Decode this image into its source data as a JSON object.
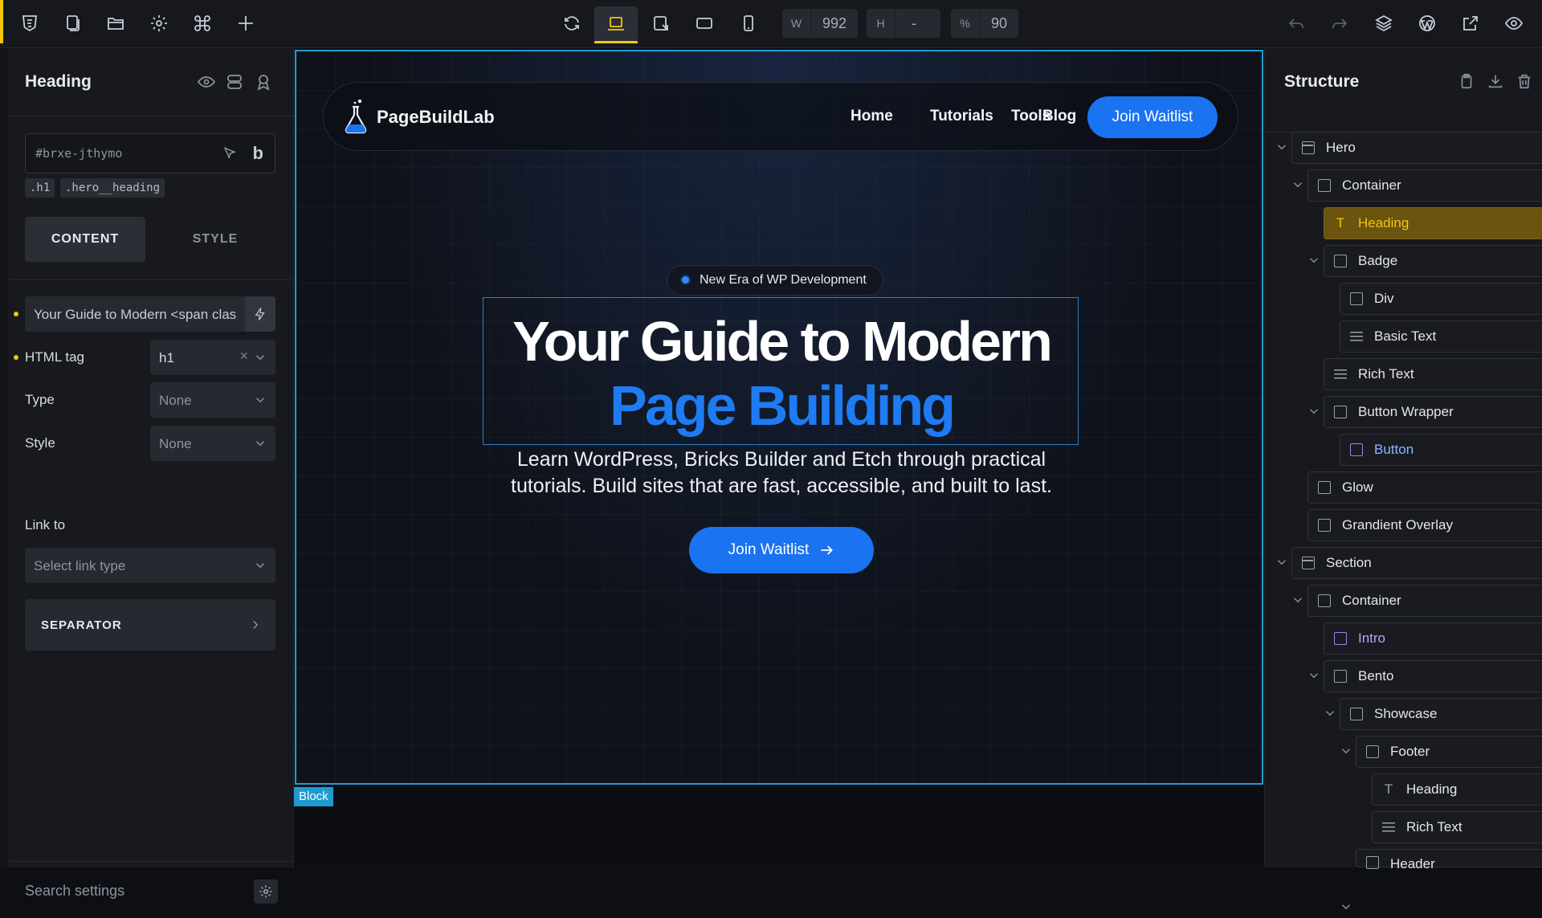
{
  "toolbar": {
    "width_label": "W",
    "width_value": "992",
    "height_label": "H",
    "height_value": "-",
    "zoom_label": "%",
    "zoom_value": "90",
    "accent_color": "#f0c808"
  },
  "left_panel": {
    "title": "Heading",
    "element_id": "#brxe-jthymo",
    "bold_label": "b",
    "classes": [
      ".h1",
      ".hero__heading"
    ],
    "tabs": [
      {
        "label": "CONTENT"
      },
      {
        "label": "STYLE"
      }
    ],
    "text_value": "Your Guide to Modern <span clas",
    "html_tag_label": "HTML tag",
    "html_tag_value": "h1",
    "type_label": "Type",
    "type_value": "None",
    "style_label": "Style",
    "style_value": "None",
    "link_label": "Link to",
    "link_placeholder": "Select link type",
    "separator_label": "SEPARATOR",
    "search_settings": "Search settings"
  },
  "canvas": {
    "block_tag": "Block",
    "brand": "PageBuildLab",
    "nav_links": [
      "Home",
      "Tutorials",
      "Tools",
      "Blog"
    ],
    "nav_cta": "Join Waitlist",
    "badge": "New Era of WP Development",
    "heading_line1": "Your Guide to Modern",
    "heading_line2": "Page Building",
    "subtitle_line1": "Learn WordPress, Bricks Builder and Etch through practical",
    "subtitle_line2": "tutorials. Build sites that are fast, accessible, and built to last.",
    "hero_cta": "Join Waitlist",
    "brand_blue": "#1a73f0"
  },
  "right_panel": {
    "title": "Structure",
    "tree": [
      {
        "label": "Hero"
      },
      {
        "label": "Container"
      },
      {
        "label": "Heading"
      },
      {
        "label": "Badge"
      },
      {
        "label": "Div"
      },
      {
        "label": "Basic Text"
      },
      {
        "label": "Rich Text"
      },
      {
        "label": "Button Wrapper"
      },
      {
        "label": "Button"
      },
      {
        "label": "Glow"
      },
      {
        "label": "Grandient Overlay"
      },
      {
        "label": "Section"
      },
      {
        "label": "Container"
      },
      {
        "label": "Intro"
      },
      {
        "label": "Bento"
      },
      {
        "label": "Showcase"
      },
      {
        "label": "Footer"
      },
      {
        "label": "Heading"
      },
      {
        "label": "Rich Text"
      },
      {
        "label": "Header"
      }
    ]
  }
}
